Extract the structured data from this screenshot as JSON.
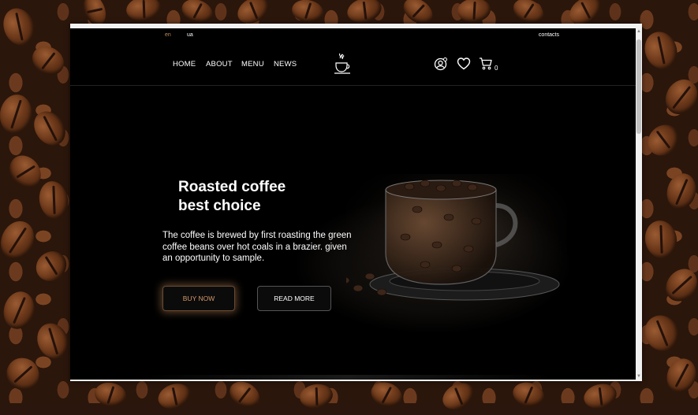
{
  "topbar": {
    "lang_en": "en",
    "lang_ua": "ua",
    "contacts": "contacts"
  },
  "nav": {
    "home": "HOME",
    "about": "ABOUT",
    "menu": "MENU",
    "news": "NEWS",
    "cart_count": "0"
  },
  "hero": {
    "title_line1": "Roasted coffee",
    "title_line2": "best choice",
    "description": "The coffee is brewed by first roasting the green coffee beans over hot coals in a brazier. given an opportunity to sample.",
    "buy_button": "BUY NOW",
    "read_button": "READ MORE"
  },
  "icons": [
    "user-icon",
    "heart-icon",
    "cart-icon",
    "coffee-logo-icon"
  ],
  "colors": {
    "accent": "#d59a6a",
    "background": "#000000",
    "text": "#ffffff"
  }
}
